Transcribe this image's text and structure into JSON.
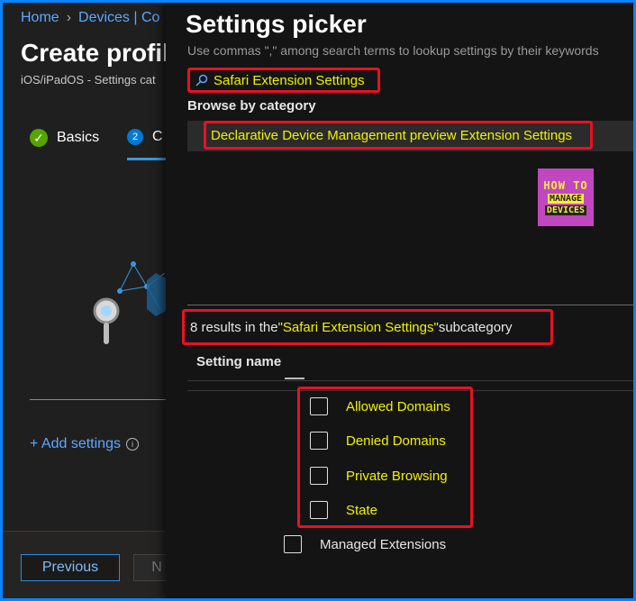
{
  "breadcrumb": {
    "home": "Home",
    "devices": "Devices | Co"
  },
  "background": {
    "title": "Create profil",
    "subtitle": "iOS/iPadOS - Settings cat",
    "steps": [
      {
        "number": "✓",
        "label": "Basics"
      },
      {
        "number": "2",
        "label": "C"
      }
    ],
    "add_settings": "+ Add settings",
    "buttons": {
      "previous": "Previous",
      "next": "N"
    }
  },
  "picker": {
    "title": "Settings picker",
    "hint": "Use commas \",\" among search terms to lookup settings by their keywords",
    "search_value": "Safari Extension Settings",
    "browse_label": "Browse by category",
    "category": "Declarative Device Management preview Extension Settings",
    "results": {
      "prefix": "8 results in the ",
      "subcategory": "\"Safari Extension Settings\"",
      "suffix": " subcategory"
    },
    "column_header": "Setting name",
    "items": [
      {
        "label": "Allowed Domains"
      },
      {
        "label": "Denied Domains"
      },
      {
        "label": "Private Browsing"
      },
      {
        "label": "State"
      },
      {
        "label": "Managed Extensions"
      }
    ]
  },
  "logo": {
    "line1": "HOW TO",
    "line2": "MANAGE",
    "line3": "DEVICES"
  },
  "colors": {
    "accent": "#0a84ff",
    "highlight": "#f2f200",
    "annotation": "#e81123"
  }
}
